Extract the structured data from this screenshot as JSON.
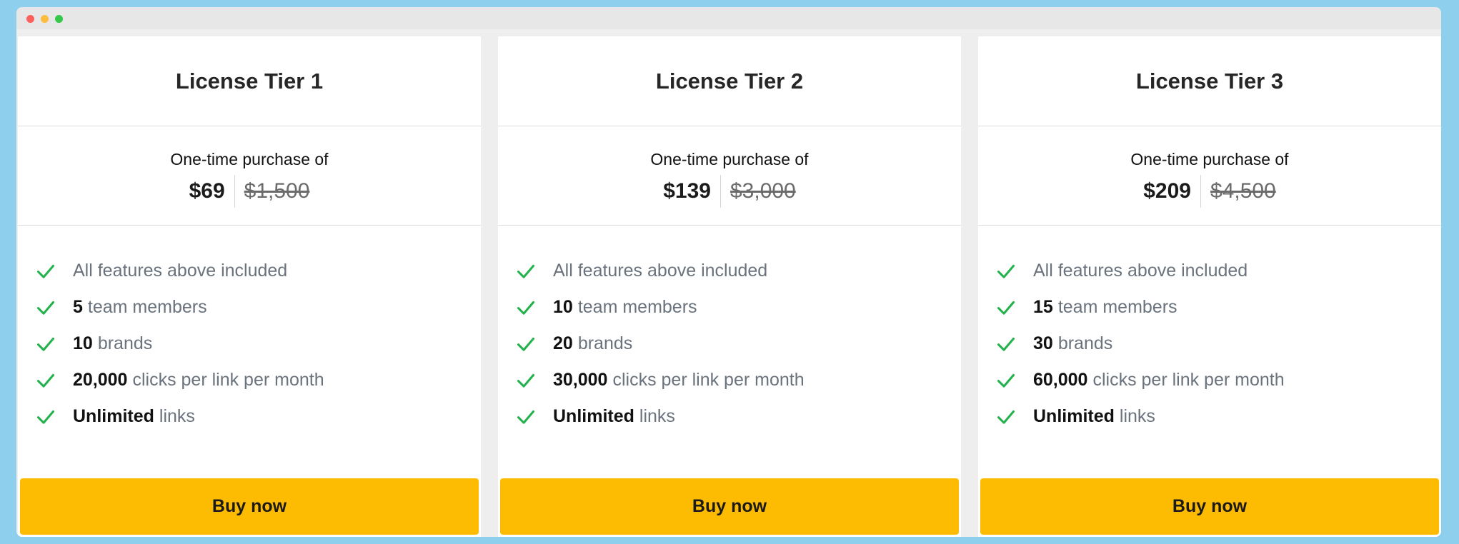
{
  "window": {
    "controls": [
      "close",
      "minimize",
      "maximize"
    ]
  },
  "colors": {
    "background": "#8ecfee",
    "button": "#fdbb02",
    "check": "#22b24c"
  },
  "tiers": [
    {
      "title": "License Tier 1",
      "purchase_label": "One-time purchase of",
      "price": "$69",
      "original_price": "$1,500",
      "features": [
        {
          "bold": "",
          "text": "All features above included"
        },
        {
          "bold": "5",
          "text": "team members"
        },
        {
          "bold": "10",
          "text": "brands"
        },
        {
          "bold": "20,000",
          "text": "clicks per link per month"
        },
        {
          "bold": "Unlimited",
          "text": "links"
        }
      ],
      "button_label": "Buy now"
    },
    {
      "title": "License Tier 2",
      "purchase_label": "One-time purchase of",
      "price": "$139",
      "original_price": "$3,000",
      "features": [
        {
          "bold": "",
          "text": "All features above included"
        },
        {
          "bold": "10",
          "text": "team members"
        },
        {
          "bold": "20",
          "text": "brands"
        },
        {
          "bold": "30,000",
          "text": "clicks per link per month"
        },
        {
          "bold": "Unlimited",
          "text": "links"
        }
      ],
      "button_label": "Buy now"
    },
    {
      "title": "License Tier 3",
      "purchase_label": "One-time purchase of",
      "price": "$209",
      "original_price": "$4,500",
      "features": [
        {
          "bold": "",
          "text": "All features above included"
        },
        {
          "bold": "15",
          "text": "team members"
        },
        {
          "bold": "30",
          "text": "brands"
        },
        {
          "bold": "60,000",
          "text": "clicks per link per month"
        },
        {
          "bold": "Unlimited",
          "text": "links"
        }
      ],
      "button_label": "Buy now"
    }
  ]
}
